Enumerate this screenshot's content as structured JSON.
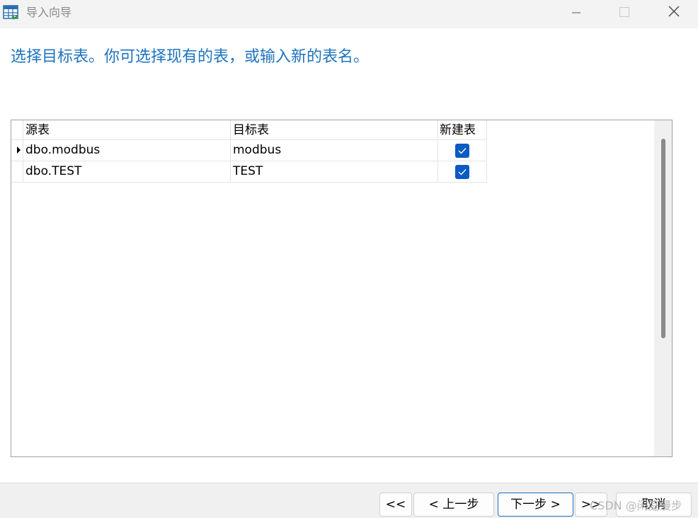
{
  "window": {
    "title": "导入向导",
    "icons": {
      "app": "table-import-icon",
      "minimize": "minimize-icon",
      "maximize": "maximize-icon",
      "close": "close-icon"
    }
  },
  "heading": "选择目标表。你可选择现有的表，或输入新的表名。",
  "grid": {
    "columns": [
      "源表",
      "目标表",
      "新建表"
    ],
    "rows": [
      {
        "source": "dbo.modbus",
        "target": "modbus",
        "create_new": true,
        "current": true
      },
      {
        "source": "dbo.TEST",
        "target": "TEST",
        "create_new": true,
        "current": false
      }
    ]
  },
  "buttons": {
    "first": "<<",
    "prev": "< 上一步",
    "next": "下一步 >",
    "last": ">>",
    "cancel": "取消"
  },
  "watermark": "CSDN @闲庭漫步",
  "colors": {
    "heading": "#1e73be",
    "checkbox": "#0a5bc4",
    "next_border": "#1f6fc5"
  }
}
